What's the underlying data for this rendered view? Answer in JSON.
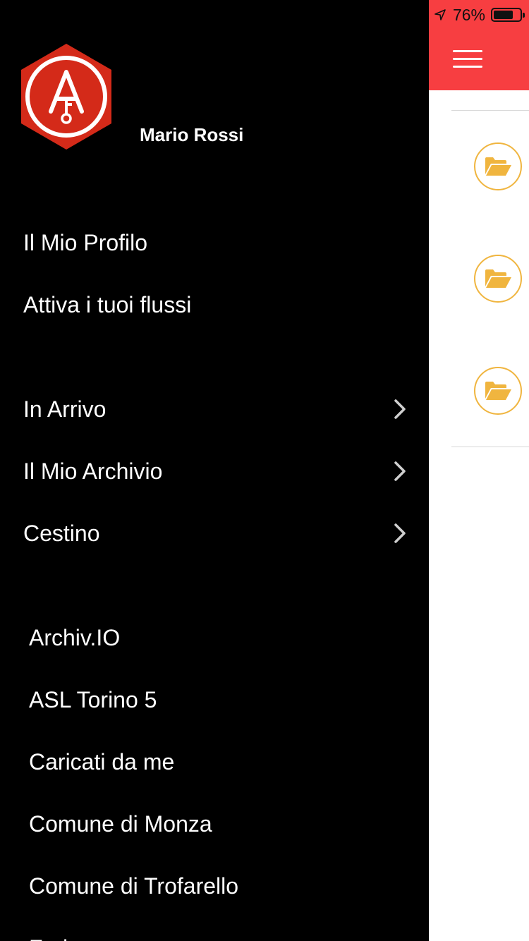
{
  "status_bar": {
    "battery_percent": "76%",
    "battery_level": 0.76
  },
  "drawer": {
    "user_name": "Mario Rossi",
    "profile_items": [
      {
        "label": "Il Mio Profilo"
      },
      {
        "label": "Attiva i tuoi flussi"
      }
    ],
    "folder_items": [
      {
        "label": "In Arrivo"
      },
      {
        "label": "Il Mio Archivio"
      },
      {
        "label": "Cestino"
      }
    ],
    "flow_items": [
      {
        "label": "Archiv.IO"
      },
      {
        "label": "ASL Torino 5"
      },
      {
        "label": "Caricati da me"
      },
      {
        "label": "Comune di Monza"
      },
      {
        "label": "Comune di Trofarello"
      },
      {
        "label": "Fad..."
      }
    ]
  },
  "icons": {
    "logo": "archivio-logo-icon",
    "menu": "hamburger-menu-icon",
    "folder": "folder-open-icon",
    "chevron": "chevron-right-icon",
    "location": "location-arrow-icon",
    "battery": "battery-icon"
  },
  "colors": {
    "header_red": "#f73e41",
    "logo_red": "#d42a19",
    "folder_orange": "#f0b53f",
    "drawer_bg": "#000000"
  }
}
